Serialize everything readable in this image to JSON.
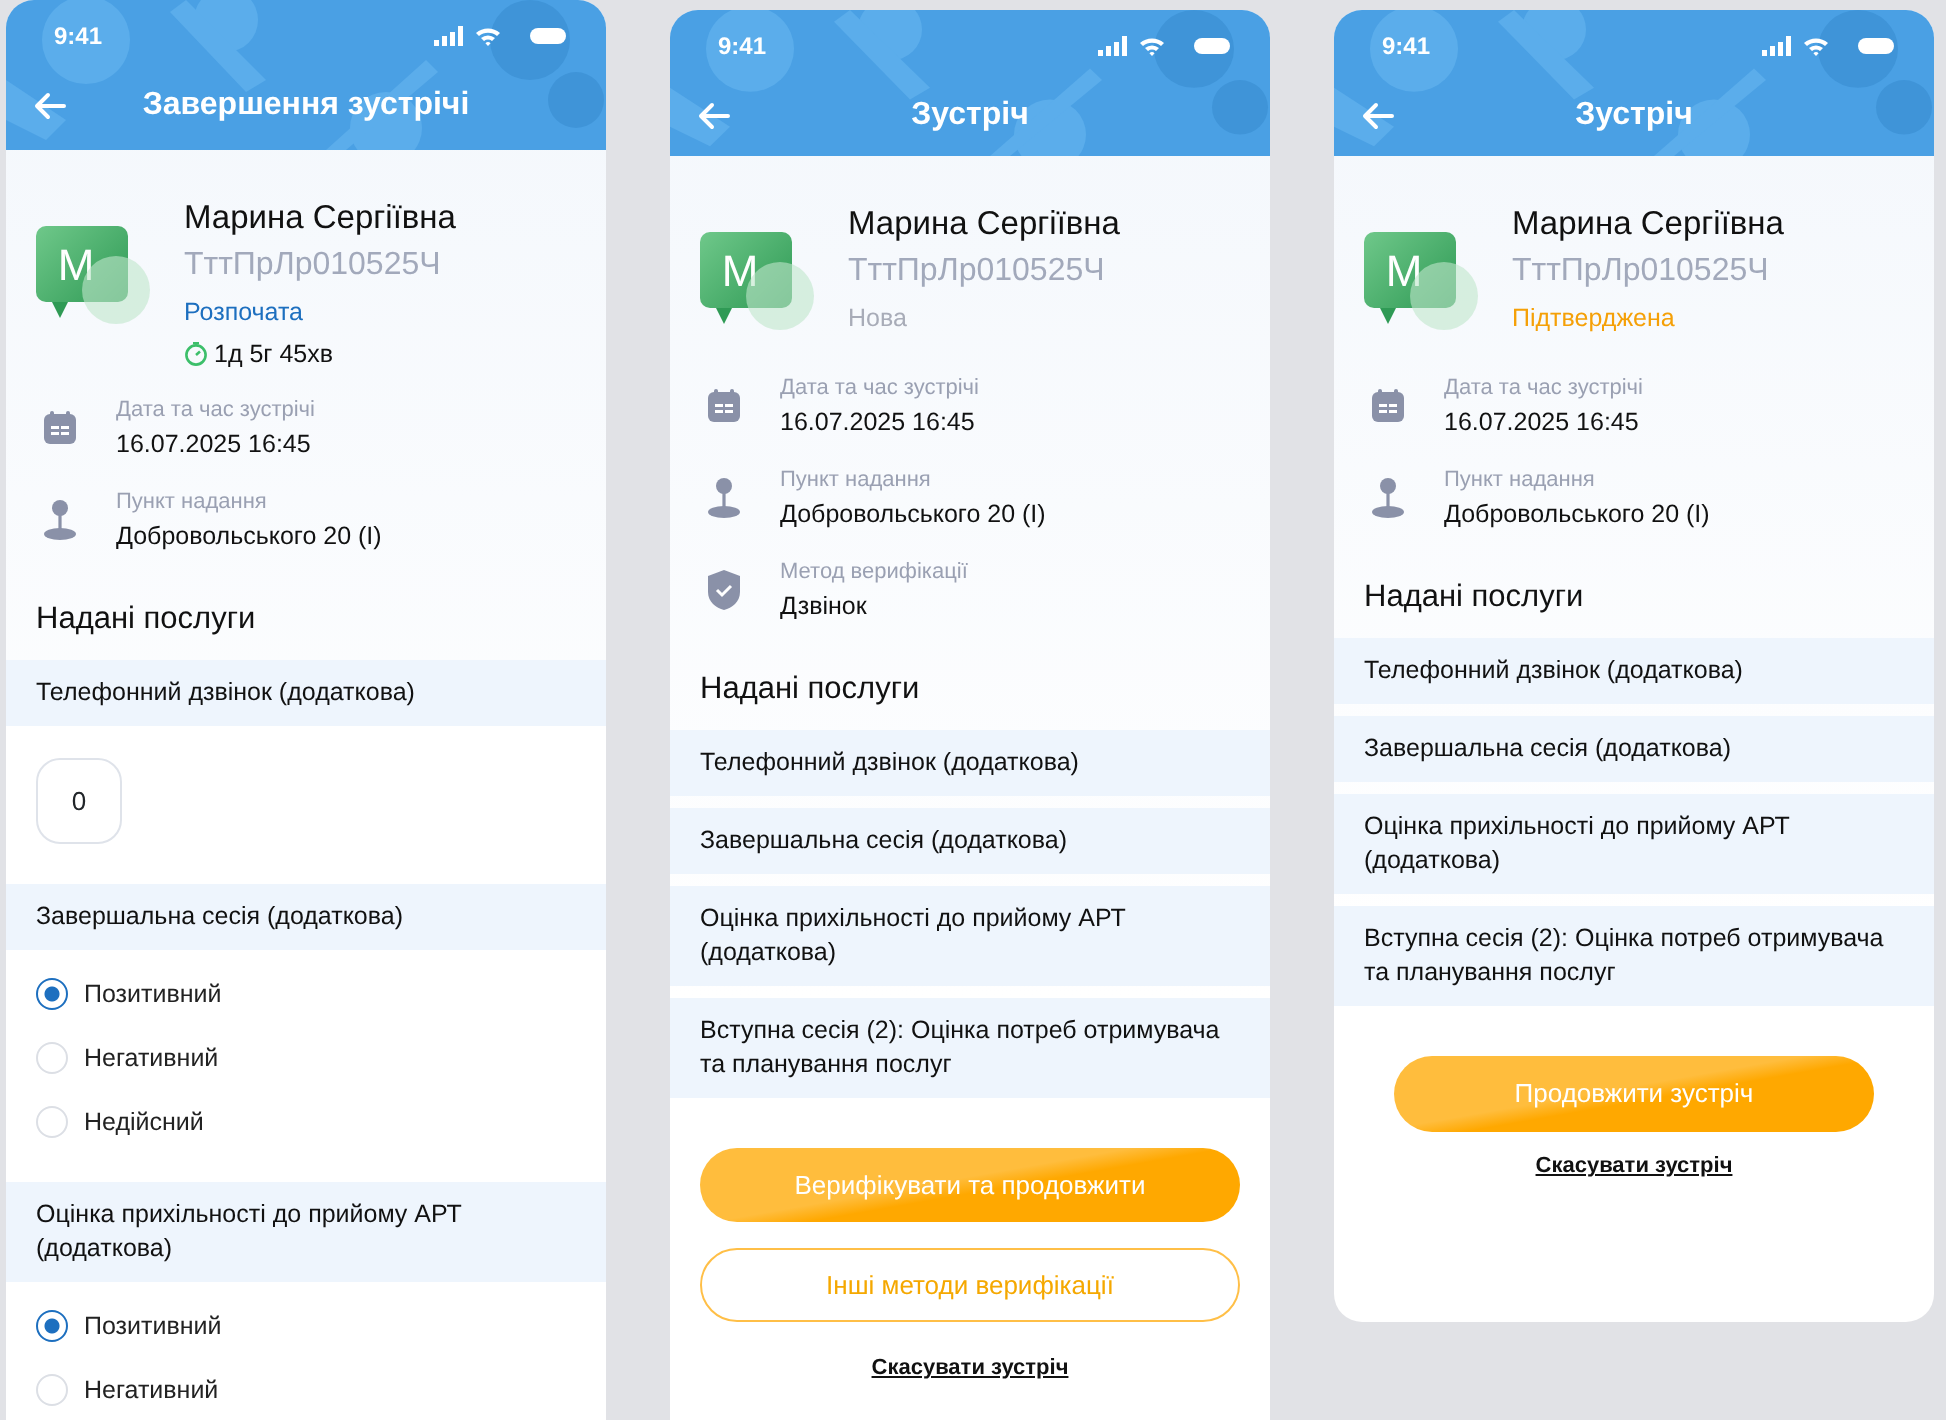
{
  "screens": [
    {
      "status_time": "9:41",
      "title": "Завершення зустрічі",
      "patient": {
        "avatar_letter": "М",
        "name": "Марина Сергіївна",
        "code": "ТттПрЛр010525Ч",
        "status": {
          "text": "Розпочата",
          "kind": "started"
        },
        "timer": "1д 5г 45хв"
      },
      "details": [
        {
          "kind": "calendar",
          "label": "Дата та час зустрічі",
          "value": "16.07.2025 16:45"
        },
        {
          "kind": "pin",
          "label": "Пункт надання",
          "value": "Добровольського 20 (І)"
        }
      ],
      "services_title": "Надані послуги",
      "services": [
        {
          "title": "Телефонний дзвінок (додаткова)",
          "kind": "counter",
          "value": "0"
        },
        {
          "title": "Завершальна сесія (додаткова)",
          "kind": "radio",
          "options": [
            {
              "label": "Позитивний",
              "selected": true
            },
            {
              "label": "Негативний",
              "selected": false
            },
            {
              "label": "Недійсний",
              "selected": false
            }
          ]
        },
        {
          "title": "Оцінка прихільності до прийому АРТ (додаткова)",
          "kind": "radio",
          "options": [
            {
              "label": "Позитивний",
              "selected": true
            },
            {
              "label": "Негативний",
              "selected": false
            }
          ]
        }
      ]
    },
    {
      "status_time": "9:41",
      "title": "Зустріч",
      "patient": {
        "avatar_letter": "М",
        "name": "Марина Сергіївна",
        "code": "ТттПрЛр010525Ч",
        "status": {
          "text": "Нова",
          "kind": "new"
        }
      },
      "details": [
        {
          "kind": "calendar",
          "label": "Дата та час зустрічі",
          "value": "16.07.2025 16:45"
        },
        {
          "kind": "pin",
          "label": "Пункт надання",
          "value": "Добровольського 20 (І)"
        },
        {
          "kind": "shield",
          "label": "Метод верифікації",
          "value": "Дзвінок"
        }
      ],
      "services_title": "Надані послуги",
      "services": [
        {
          "title": "Телефонний дзвінок (додаткова)",
          "kind": "plain"
        },
        {
          "title": "Завершальна сесія (додаткова)",
          "kind": "plain"
        },
        {
          "title": "Оцінка прихільності до прийому АРТ (додаткова)",
          "kind": "plain"
        },
        {
          "title": "Вступна сесія (2): Оцінка потреб отримувача та планування послуг",
          "kind": "plain"
        }
      ],
      "actions": [
        {
          "label": "Верифікувати та продовжити",
          "kind": "primary"
        },
        {
          "label": "Інші методи верифікації",
          "kind": "outline"
        },
        {
          "label": "Скасувати зустріч",
          "kind": "link"
        }
      ]
    },
    {
      "status_time": "9:41",
      "title": "Зустріч",
      "patient": {
        "avatar_letter": "М",
        "name": "Марина Сергіївна",
        "code": "ТттПрЛр010525Ч",
        "status": {
          "text": "Підтверджена",
          "kind": "confirmed"
        }
      },
      "details": [
        {
          "kind": "calendar",
          "label": "Дата та час зустрічі",
          "value": "16.07.2025 16:45"
        },
        {
          "kind": "pin",
          "label": "Пункт надання",
          "value": "Добровольського 20 (І)"
        }
      ],
      "services_title": "Надані послуги",
      "services": [
        {
          "title": "Телефонний дзвінок (додаткова)",
          "kind": "plain"
        },
        {
          "title": "Завершальна сесія (додаткова)",
          "kind": "plain"
        },
        {
          "title": "Оцінка прихільності до прийому АРТ (додаткова)",
          "kind": "plain"
        },
        {
          "title": "Вступна сесія (2): Оцінка потреб отримувача та планування послуг",
          "kind": "plain"
        }
      ],
      "actions": [
        {
          "label": "Продовжити зустріч",
          "kind": "primary-narrow"
        },
        {
          "label": "Скасувати зустріч",
          "kind": "link"
        }
      ]
    }
  ]
}
